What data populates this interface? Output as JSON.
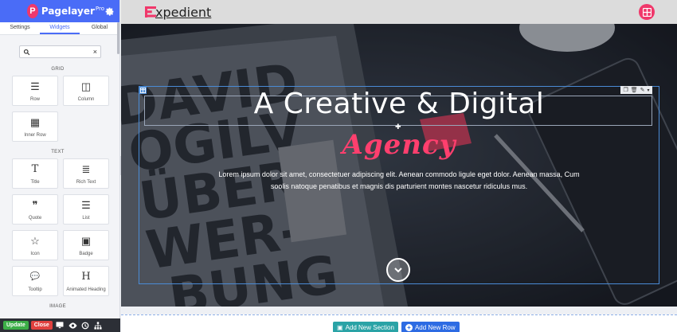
{
  "sidebar": {
    "brand": "Pagelayer",
    "brand_sup": "Pro",
    "tabs": [
      "Settings",
      "Widgets",
      "Global"
    ],
    "search_placeholder": "",
    "sections": [
      {
        "title": "GRID",
        "widgets": [
          {
            "label": "Row",
            "icon": "row-icon",
            "glyph": "☰"
          },
          {
            "label": "Column",
            "icon": "column-icon",
            "glyph": "◫"
          },
          {
            "label": "Inner Row",
            "icon": "inner-row-icon",
            "glyph": "▦"
          }
        ]
      },
      {
        "title": "TEXT",
        "widgets": [
          {
            "label": "Title",
            "icon": "title-icon",
            "glyph": "T"
          },
          {
            "label": "Rich Text",
            "icon": "rich-text-icon",
            "glyph": "≣"
          },
          {
            "label": "Quote",
            "icon": "quote-icon",
            "glyph": "❞"
          },
          {
            "label": "List",
            "icon": "list-icon",
            "glyph": "☰"
          },
          {
            "label": "Icon",
            "icon": "star-icon",
            "glyph": "☆"
          },
          {
            "label": "Badge",
            "icon": "badge-icon",
            "glyph": "▣"
          },
          {
            "label": "Tooltip",
            "icon": "tooltip-icon",
            "glyph": "💬"
          },
          {
            "label": "Animated Heading",
            "icon": "heading-icon",
            "glyph": "H"
          }
        ]
      },
      {
        "title": "IMAGE",
        "widgets": []
      }
    ],
    "footer": {
      "update": "Update",
      "close": "Close"
    }
  },
  "page": {
    "brand_text": "xpedient",
    "hero_title": "A Creative & Digital",
    "hero_subtitle": "Agency",
    "hero_description": "Lorem ipsum dolor sit amet, consectetuer adipiscing elit. Aenean commodo ligule eget dolor. Aenean massa, Cum soolis natoque penatibus et magnis dis parturient montes nascetur ridiculus mus.",
    "add_section": "Add New Section",
    "add_row": "Add New Row"
  },
  "colors": {
    "accent": "#4a6cf7",
    "brand_pink": "#f0386b",
    "update_green": "#3cae47",
    "close_red": "#e0413f"
  }
}
